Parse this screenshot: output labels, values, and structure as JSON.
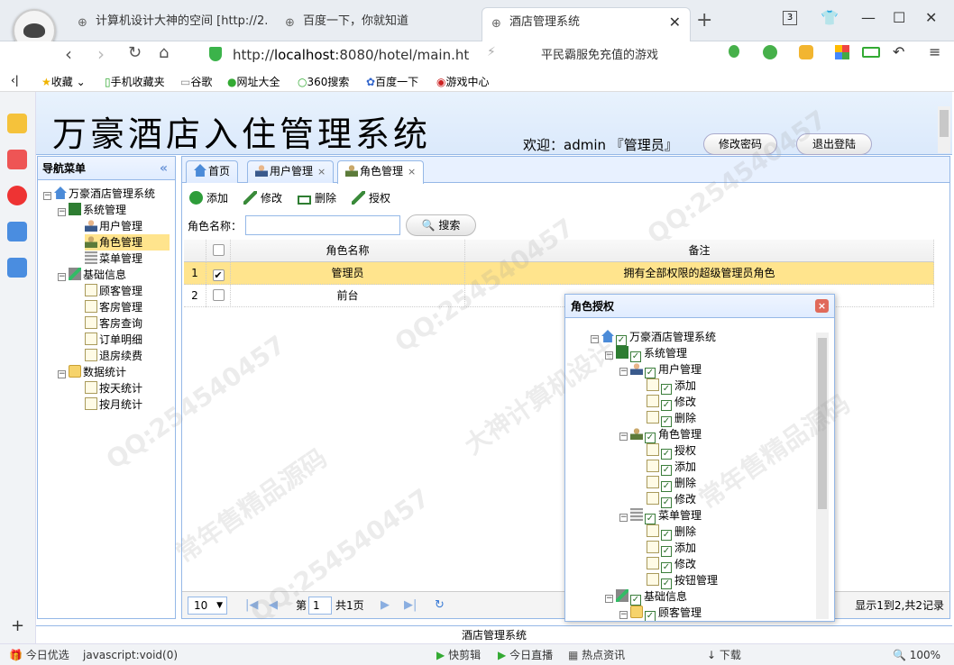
{
  "browser": {
    "tabs": [
      {
        "label": "计算机设计大神的空间 [http://2..."
      },
      {
        "label": "百度一下，你就知道"
      },
      {
        "label": "酒店管理系统"
      }
    ],
    "new_tab_label": "+",
    "tab_count": "3",
    "url_prefix": "http://",
    "url_host": "localhost",
    "url_rest": ":8080/hotel/main.ht",
    "address_right_text": "平民霸服免充值的游戏",
    "bookmarks": [
      "收藏",
      "手机收藏夹",
      "谷歌",
      "网址大全",
      "360搜索",
      "百度一下",
      "游戏中心"
    ]
  },
  "app": {
    "title": "万豪酒店入住管理系统",
    "welcome": "欢迎：admin 『管理员』",
    "change_password": "修改密码",
    "logout": "退出登陆",
    "nav_title": "导航菜单",
    "nav_collapse": "«",
    "tree": [
      {
        "label": "万豪酒店管理系统",
        "icon": "home-icon"
      },
      {
        "label": "系统管理",
        "icon": "grid-icon"
      },
      {
        "label": "用户管理",
        "icon": "user-icon"
      },
      {
        "label": "角色管理",
        "icon": "group-icon"
      },
      {
        "label": "菜单管理",
        "icon": "menu-icon"
      },
      {
        "label": "基础信息",
        "icon": "tools-icon"
      },
      {
        "label": "顾客管理",
        "icon": "file-icon"
      },
      {
        "label": "客房管理",
        "icon": "file-icon"
      },
      {
        "label": "客房查询",
        "icon": "file-icon"
      },
      {
        "label": "订单明细",
        "icon": "file-icon"
      },
      {
        "label": "退房续费",
        "icon": "file-icon"
      },
      {
        "label": "数据统计",
        "icon": "folder-icon"
      },
      {
        "label": "按天统计",
        "icon": "file-icon"
      },
      {
        "label": "按月统计",
        "icon": "file-icon"
      }
    ],
    "tabs": [
      {
        "label": "首页"
      },
      {
        "label": "用户管理"
      },
      {
        "label": "角色管理"
      }
    ],
    "tab_close": "×",
    "toolbar": {
      "add": "添加",
      "edit": "修改",
      "delete": "删除",
      "grant": "授权"
    },
    "search_label": "角色名称：",
    "search_value": "",
    "search_button": "搜索",
    "grid": {
      "columns": [
        "角色名称",
        "备注"
      ],
      "rows": [
        {
          "no": "1",
          "name": "管理员",
          "remark": "拥有全部权限的超级管理员角色",
          "checked": "✔"
        },
        {
          "no": "2",
          "name": "前台",
          "remark": "",
          "checked": ""
        }
      ]
    },
    "pager": {
      "page_size": "10",
      "page_label": "第",
      "page_value": "1",
      "total_pages": "共1页",
      "summary": "显示1到2,共2记录"
    },
    "footer": "酒店管理系统",
    "dialog": {
      "title": "角色授权",
      "close": "×",
      "tree": [
        "万豪酒店管理系统",
        "系统管理",
        "用户管理",
        "添加",
        "修改",
        "删除",
        "角色管理",
        "授权",
        "添加",
        "删除",
        "修改",
        "菜单管理",
        "删除",
        "添加",
        "修改",
        "按钮管理",
        "基础信息",
        "顾客管理"
      ]
    }
  },
  "statusbar": {
    "items": [
      "今日优选",
      "javascript:void(0)",
      "快剪辑",
      "今日直播",
      "热点资讯",
      "下载",
      "100%"
    ]
  },
  "watermarks": [
    "QQ:254540457",
    "大神计算机设计",
    "常年售精品源码"
  ]
}
